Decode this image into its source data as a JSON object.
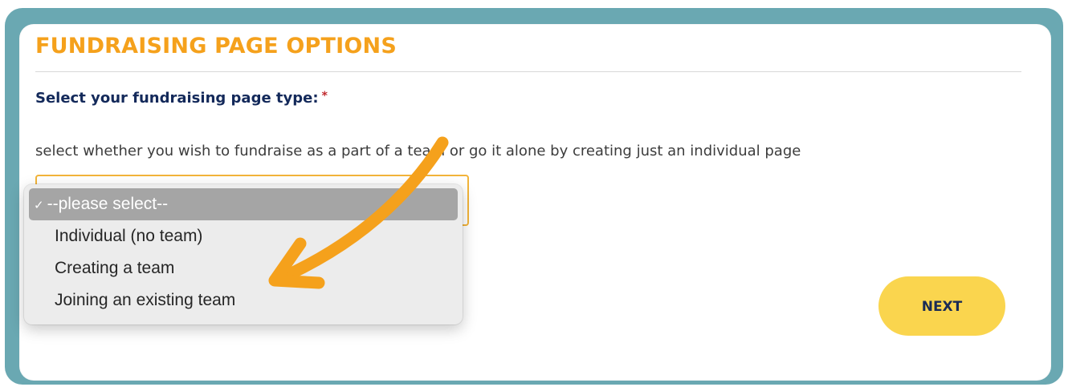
{
  "form": {
    "title": "FUNDRAISING PAGE OPTIONS",
    "field_label": "Select your fundraising page type:",
    "required_marker": "*",
    "description": "select whether you wish to fundraise as a part of a team or go it alone by creating just an individual page"
  },
  "dropdown": {
    "chevron": "⌄",
    "options": [
      {
        "label": "--please select--",
        "selected": true,
        "check": "✓"
      },
      {
        "label": "Individual (no team)",
        "selected": false
      },
      {
        "label": "Creating a team",
        "selected": false
      },
      {
        "label": "Joining an existing team",
        "selected": false
      }
    ]
  },
  "actions": {
    "next_label": "NEXT"
  },
  "annotation": {
    "arrow_icon": "curved-arrow-icon",
    "arrow_color": "#f5a11c"
  },
  "colors": {
    "frame": "#6aa8b2",
    "title": "#f5a11c",
    "label": "#13295a",
    "required": "#c0282d",
    "select_border": "#f2b43a",
    "next_button": "#fad54e"
  }
}
